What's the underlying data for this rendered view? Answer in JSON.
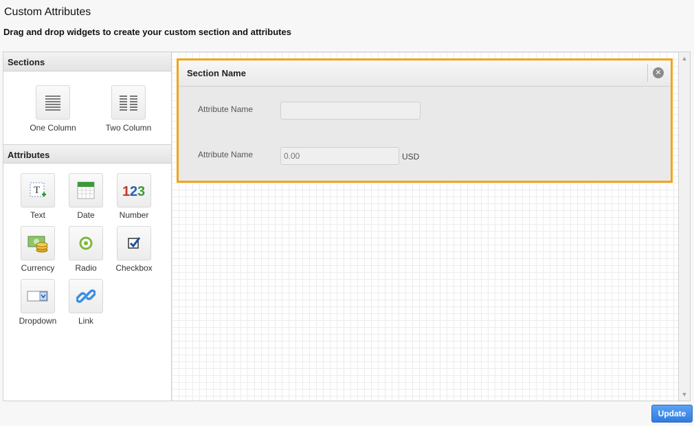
{
  "page": {
    "title": "Custom Attributes",
    "subtitle": "Drag and drop widgets to create your custom section and attributes"
  },
  "palette": {
    "sections_header": "Sections",
    "sections": [
      {
        "label": "One Column",
        "icon": "one-column-icon"
      },
      {
        "label": "Two Column",
        "icon": "two-column-icon"
      }
    ],
    "attributes_header": "Attributes",
    "attributes": [
      {
        "label": "Text",
        "icon": "text-icon"
      },
      {
        "label": "Date",
        "icon": "calendar-icon"
      },
      {
        "label": "Number",
        "icon": "number-icon"
      },
      {
        "label": "Currency",
        "icon": "currency-icon"
      },
      {
        "label": "Radio",
        "icon": "radio-icon"
      },
      {
        "label": "Checkbox",
        "icon": "checkbox-icon"
      },
      {
        "label": "Dropdown",
        "icon": "dropdown-icon"
      },
      {
        "label": "Link",
        "icon": "link-icon"
      }
    ]
  },
  "canvas": {
    "section": {
      "name": "Section Name",
      "fields": [
        {
          "label": "Attribute Name",
          "value": "",
          "placeholder": ""
        },
        {
          "label": "Attribute Name",
          "value": "",
          "placeholder": "0.00",
          "unit": "USD"
        }
      ]
    }
  },
  "footer": {
    "update_label": "Update"
  },
  "colors": {
    "accent_border": "#f2a516",
    "button": "#2f7be0"
  }
}
